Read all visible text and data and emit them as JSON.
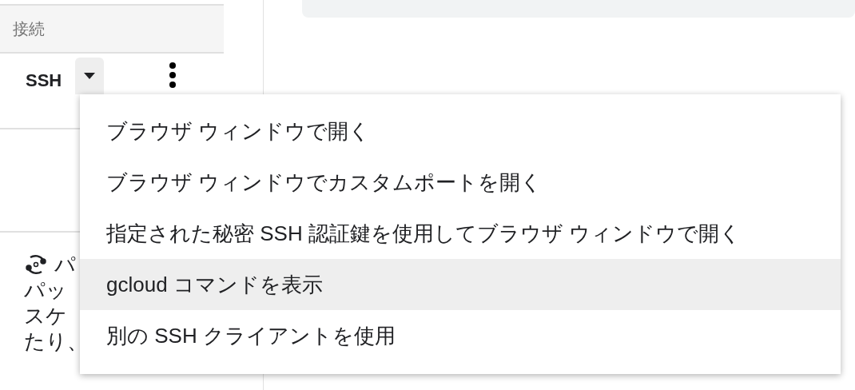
{
  "column_header": {
    "label": "接続"
  },
  "connection": {
    "label": "SSH"
  },
  "section": {
    "title": "パ",
    "lines": [
      "パッ",
      "スケ",
      "たり、"
    ]
  },
  "menu": {
    "items": [
      {
        "label": "ブラウザ ウィンドウで開く",
        "selected": false
      },
      {
        "label": "ブラウザ ウィンドウでカスタムポートを開く",
        "selected": false
      },
      {
        "label": "指定された秘密 SSH 認証鍵を使用してブラウザ ウィンドウで開く",
        "selected": false
      },
      {
        "label": "gcloud コマンドを表示",
        "selected": true
      },
      {
        "label": "別の SSH クライアントを使用",
        "selected": false
      }
    ]
  }
}
